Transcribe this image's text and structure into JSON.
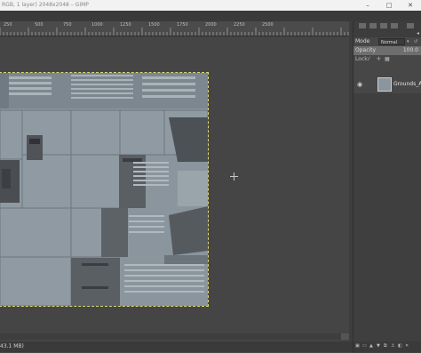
{
  "window": {
    "title": "RGB, 1 layer) 2048x2048 – GIMP",
    "minimize": "–",
    "maximize": "□",
    "close": "✕"
  },
  "ruler": {
    "ticks": [
      "250",
      "500",
      "750",
      "1000",
      "1250",
      "1500",
      "1750",
      "2000",
      "2250",
      "2500"
    ]
  },
  "status": {
    "info": "43.1 MB)"
  },
  "layers_panel": {
    "mode_label": "Mode",
    "mode_value": "Normal",
    "opacity_label": "Opacity",
    "opacity_value": "100.0",
    "opacity_fraction": 1.0,
    "lock_label": "Lock:",
    "layer_name": "Grounds_Alb",
    "icons": [
      "brush-lock-icon",
      "position-lock-icon",
      "alpha-lock-icon",
      "visibility-eye-icon"
    ]
  }
}
